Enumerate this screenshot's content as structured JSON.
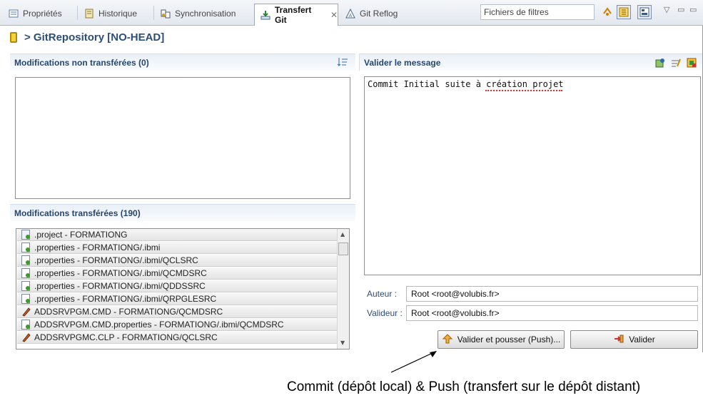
{
  "tabs": [
    {
      "label": "Propriétés",
      "icon": "properties-icon"
    },
    {
      "label": "Historique",
      "icon": "history-icon"
    },
    {
      "label": "Synchronisation",
      "icon": "synchronize-icon"
    },
    {
      "label": "Transfert Git",
      "icon": "git-staging-icon",
      "active": true
    },
    {
      "label": "Git Reflog",
      "icon": "git-reflog-icon"
    }
  ],
  "toolbar": {
    "filter_placeholder": "Fichiers de filtres"
  },
  "title": "> GitRepository [NO-HEAD]",
  "unstaged": {
    "header": "Modifications non transférées (0)"
  },
  "staged": {
    "header": "Modifications transférées (190)",
    "items": [
      {
        "label": ".project - FORMATIONG",
        "icon": "xml-file-icon"
      },
      {
        "label": ".properties - FORMATIONG/.ibmi",
        "icon": "file-added-icon"
      },
      {
        "label": ".properties - FORMATIONG/.ibmi/QCLSRC",
        "icon": "file-added-icon"
      },
      {
        "label": ".properties - FORMATIONG/.ibmi/QCMDSRC",
        "icon": "file-added-icon"
      },
      {
        "label": ".properties - FORMATIONG/.ibmi/QDDSSRC",
        "icon": "file-added-icon"
      },
      {
        "label": ".properties - FORMATIONG/.ibmi/QRPGLESRC",
        "icon": "file-added-icon"
      },
      {
        "label": "ADDSRVPGM.CMD - FORMATIONG/QCMDSRC",
        "icon": "source-member-icon"
      },
      {
        "label": "ADDSRVPGM.CMD.properties - FORMATIONG/.ibmi/QCMDSRC",
        "icon": "file-added-icon"
      },
      {
        "label": "ADDSRVPGMC.CLP - FORMATIONG/QCLSRC",
        "icon": "source-member-icon"
      }
    ]
  },
  "commit": {
    "header": "Valider le message",
    "message": "Commit Initial suite à création projet",
    "author_label": "Auteur :",
    "author_value": "Root <root@volubis.fr>",
    "committer_label": "Valideur :",
    "committer_value": "Root <root@volubis.fr>",
    "commit_push_label": "Valider et pousser (Push)...",
    "commit_label": "Valider"
  },
  "annotation": "Commit (dépôt local) & Push (transfert sur le dépôt distant)"
}
